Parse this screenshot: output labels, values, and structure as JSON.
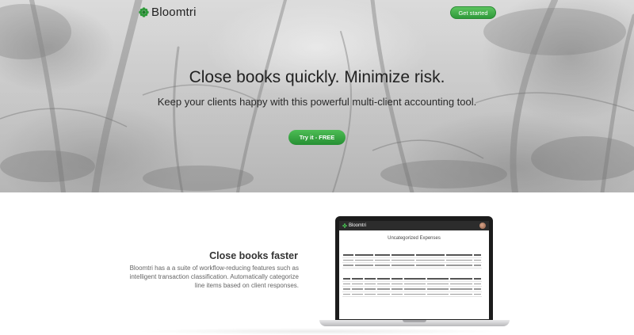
{
  "header": {
    "brand_name": "Bloomtri",
    "brand_icon": "flower-logo-icon",
    "cta_label": "Get started",
    "accent_color": "#3aa845"
  },
  "hero": {
    "headline": "Close books quickly. Minimize risk.",
    "subline": "Keep your clients happy with this powerful multi-client accounting tool.",
    "cta_label": "Try it - FREE"
  },
  "feature": {
    "title": "Close books faster",
    "description": "Bloomtri has a a suite of workflow-reducing features such as intelligent transaction classification. Automatically categorize line items based on client responses."
  },
  "laptop_app": {
    "brand_name": "Bloomtri",
    "screen_title": "Uncategorized Expenses"
  }
}
